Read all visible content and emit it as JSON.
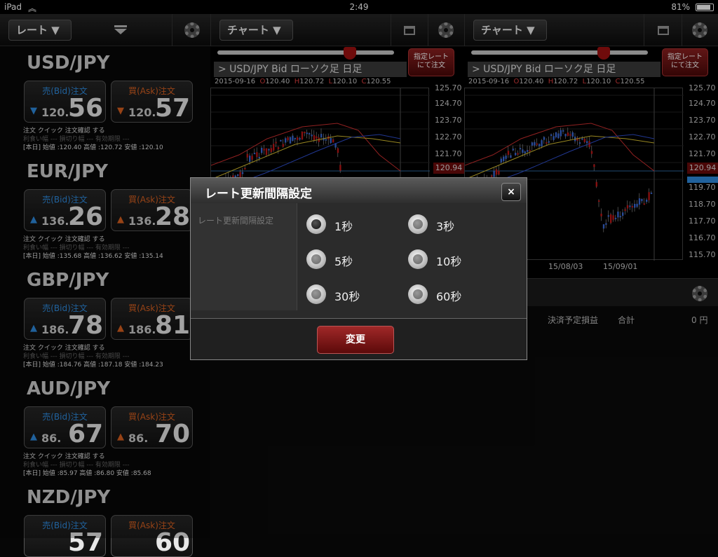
{
  "status": {
    "device": "iPad",
    "time": "2:49",
    "battery": "81%"
  },
  "toolbar": {
    "rate_label": "レート ▼",
    "chart1_label": "チャート ▼",
    "chart2_label": "チャート ▼"
  },
  "pairs": [
    {
      "name": "USD/JPY",
      "bid_label": "売(Bid)注文",
      "ask_label": "買(Ask)注文",
      "bid_arrow": "▼",
      "ask_arrow": "▼",
      "bid_small": "120.",
      "bid_big": "56",
      "ask_small": "120.",
      "ask_big": "57",
      "info1": "注文 クイック        注文確認 する",
      "info2": "利食い幅 ---    損切り幅 ---    有効期限 ---",
      "info3": "[本日]  始値 :120.40     高値 :120.72     安値 :120.10"
    },
    {
      "name": "EUR/JPY",
      "bid_label": "売(Bid)注文",
      "ask_label": "買(Ask)注文",
      "bid_arrow": "▲",
      "ask_arrow": "▲",
      "bid_small": "136.",
      "bid_big": "26",
      "ask_small": "136.",
      "ask_big": "28",
      "info1": "注文 クイック        注文確認 する",
      "info2": "利食い幅 ---    損切り幅 ---    有効期限 ---",
      "info3": "[本日]  始値 :135.68     高値 :136.62     安値 :135.14"
    },
    {
      "name": "GBP/JPY",
      "bid_label": "売(Bid)注文",
      "ask_label": "買(Ask)注文",
      "bid_arrow": "▲",
      "ask_arrow": "▲",
      "bid_small": "186.",
      "bid_big": "78",
      "ask_small": "186.",
      "ask_big": "81",
      "info1": "注文 クイック        注文確認 する",
      "info2": "利食い幅 ---    損切り幅 ---    有効期限 ---",
      "info3": "[本日]  始値 :184.76     高値 :187.18     安値 :184.23"
    },
    {
      "name": "AUD/JPY",
      "bid_label": "売(Bid)注文",
      "ask_label": "買(Ask)注文",
      "bid_arrow": "▲",
      "ask_arrow": "▲",
      "bid_small": "86.",
      "bid_big": "67",
      "ask_small": "86.",
      "ask_big": "70",
      "info1": "注文 クイック        注文確認 する",
      "info2": "利食い幅 ---    損切り幅 ---    有効期限 ---",
      "info3": "[本日]  始値 :85.97      高値 :86.80      安値 :85.68"
    },
    {
      "name": "NZD/JPY",
      "bid_label": "売(Bid)注文",
      "ask_label": "買(Ask)注文",
      "bid_arrow": "",
      "ask_arrow": "",
      "bid_small": "",
      "bid_big": "57",
      "ask_small": "",
      "ask_big": "60",
      "info1": "",
      "info2": "",
      "info3": ""
    }
  ],
  "chart": {
    "sashi_button": "指定レート\nにて注文",
    "title": "> USD/JPY  Bid  ローソク足 日足",
    "date": "2015-09-16",
    "ohlc": [
      {
        "k": "O",
        "v": "120.40"
      },
      {
        "k": "H",
        "v": "120.72"
      },
      {
        "k": "L",
        "v": "120.10"
      },
      {
        "k": "C",
        "v": "120.55"
      }
    ],
    "y_labels": [
      "125.70",
      "124.70",
      "123.70",
      "122.70",
      "121.70",
      "120.94",
      "119.70",
      "118.70",
      "117.70",
      "116.70",
      "115.70"
    ],
    "current": "120.94",
    "x_labels": [
      "15/08/03",
      "15/09/01"
    ],
    "highlight_color": "#2e8ce0"
  },
  "positions": {
    "pl_label": "決済予定損益",
    "total_label": "合計",
    "total_value": "0 円"
  },
  "modal": {
    "title": "レート更新間隔設定",
    "close": "×",
    "label": "レート更新間隔設定",
    "options": [
      {
        "label": "1秒",
        "selected": true
      },
      {
        "label": "3秒",
        "selected": false
      },
      {
        "label": "5秒",
        "selected": false
      },
      {
        "label": "10秒",
        "selected": false
      },
      {
        "label": "30秒",
        "selected": false
      },
      {
        "label": "60秒",
        "selected": false
      }
    ],
    "button": "変更"
  }
}
